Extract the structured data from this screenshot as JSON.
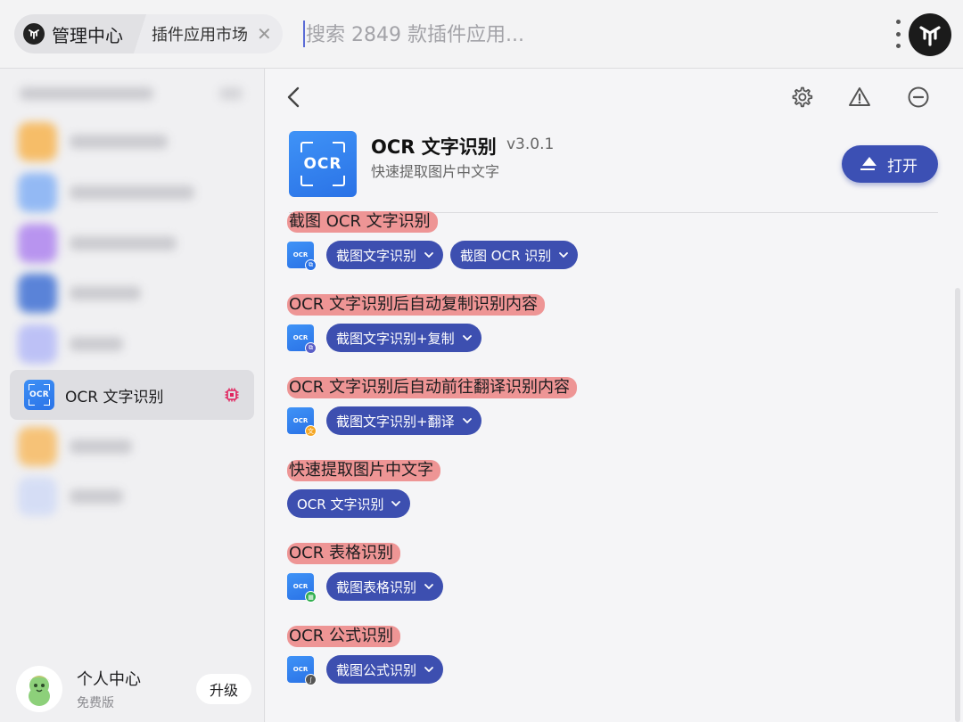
{
  "topbar": {
    "crumb_main": "管理中心",
    "crumb_sub": "插件应用市场",
    "search_placeholder": "搜索 2849 款插件应用..."
  },
  "sidebar": {
    "active_item": "OCR 文字识别",
    "user": {
      "name": "个人中心",
      "plan": "免费版",
      "upgrade": "升级"
    }
  },
  "plugin": {
    "name": "OCR 文字识别",
    "version": "v3.0.1",
    "description": "快速提取图片中文字",
    "open_label": "打开",
    "logo_text": "OCR"
  },
  "features": [
    {
      "title": "截图 OCR 文字识别",
      "has_icon": true,
      "badge": "⧉",
      "badge_color": "#2a72e6",
      "commands": [
        "截图文字识别",
        "截图 OCR 识别"
      ]
    },
    {
      "title": "OCR 文字识别后自动复制识别内容",
      "has_icon": true,
      "badge": "⧉",
      "badge_color": "#5b5fc7",
      "commands": [
        "截图文字识别+复制"
      ]
    },
    {
      "title": "OCR 文字识别后自动前往翻译识别内容",
      "has_icon": true,
      "badge": "文",
      "badge_color": "#f5a623",
      "commands": [
        "截图文字识别+翻译"
      ]
    },
    {
      "title": "快速提取图片中文字",
      "has_icon": false,
      "commands": [
        "OCR 文字识别"
      ]
    },
    {
      "title": "OCR 表格识别",
      "has_icon": true,
      "badge": "▦",
      "badge_color": "#2fae4e",
      "commands": [
        "截图表格识别"
      ]
    },
    {
      "title": "OCR 公式识别",
      "has_icon": true,
      "badge": "∫",
      "badge_color": "#555555",
      "commands": [
        "截图公式识别"
      ]
    }
  ],
  "colors": {
    "accent": "#3d4fb0",
    "highlight": "#ee9595",
    "chip_icon": "#e0245e"
  }
}
